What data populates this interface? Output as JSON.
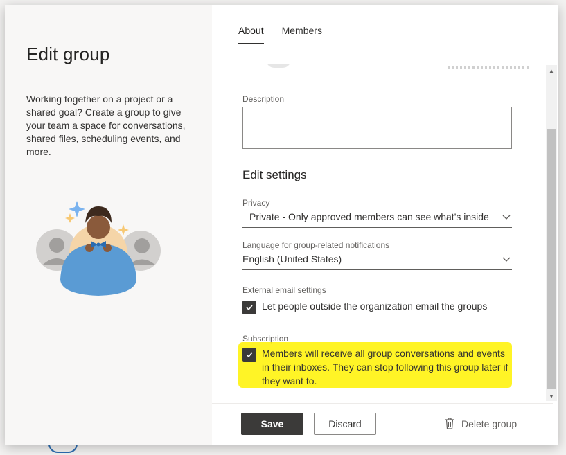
{
  "dialog": {
    "title": "Edit group",
    "intro": "Working together on a project or a shared goal? Create a group to give your team a space for conversations, shared files, scheduling events, and more."
  },
  "tabs": [
    {
      "label": "About",
      "active": true
    },
    {
      "label": "Members",
      "active": false
    }
  ],
  "form": {
    "description_label": "Description",
    "description_value": "",
    "edit_settings_title": "Edit settings",
    "privacy_label": "Privacy",
    "privacy_value": "Private - Only approved members can see what's inside",
    "language_label": "Language for group-related notifications",
    "language_value": "English (United States)",
    "external_label": "External email settings",
    "external_checkbox_text": "Let people outside the organization email the groups",
    "external_checked": true,
    "subscription_label": "Subscription",
    "subscription_checkbox_text": "Members will receive all group conversations and events in their inboxes. They can stop following this group later if they want to.",
    "subscription_checked": true
  },
  "footer": {
    "save_label": "Save",
    "discard_label": "Discard",
    "delete_label": "Delete group"
  },
  "colors": {
    "highlight": "#fff200",
    "primary_button": "#3b3a39",
    "avatar_shirt": "#5a9bd4"
  },
  "icons": [
    "check-icon",
    "chevron-down-icon",
    "trash-icon",
    "scroll-up-icon",
    "scroll-down-icon"
  ]
}
